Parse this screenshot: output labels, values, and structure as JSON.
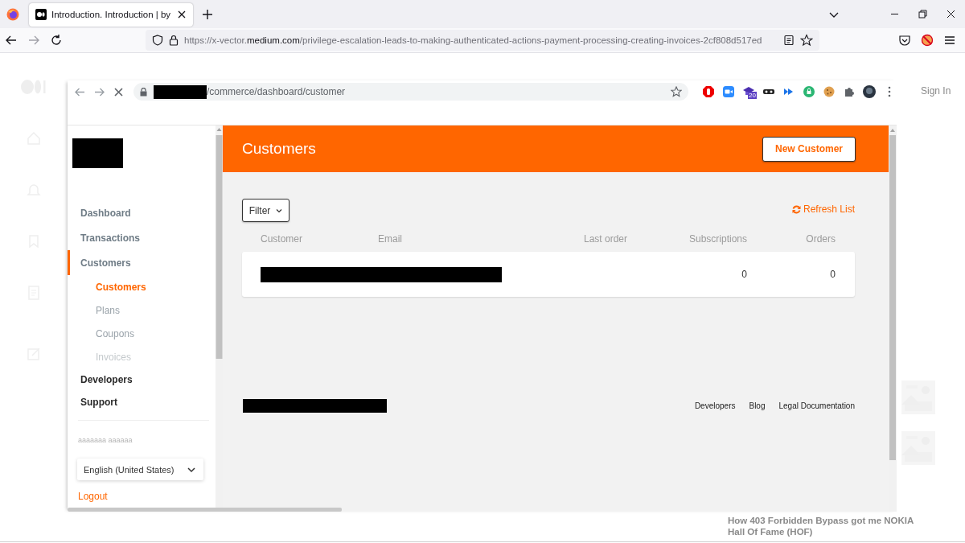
{
  "browser": {
    "tab_title": "Introduction. Introduction | by",
    "url": "https://x-vector.**medium.com**/privilege-escalation-leads-to-making-authenticated-actions-payment-processing-creating-invoices-2cf808d517ed"
  },
  "article_page": {
    "sign_in": "Sign In",
    "recommended_title": "How 403 Forbidden Bypass got me NOKIA Hall Of Fame (HOF)"
  },
  "screenshot": {
    "address_path": "/commerce/dashboard/customer",
    "extension_badge": "20",
    "sidebar": {
      "nav": [
        {
          "label": "Dashboard",
          "kind": "section",
          "selected": false
        },
        {
          "label": "Transactions",
          "kind": "section",
          "selected": false
        },
        {
          "label": "Customers",
          "kind": "section",
          "selected": true,
          "children": [
            {
              "label": "Customers",
              "selected": true
            },
            {
              "label": "Plans",
              "selected": false
            },
            {
              "label": "Coupons",
              "selected": false
            },
            {
              "label": "Invoices",
              "selected": false
            }
          ]
        },
        {
          "label": "Developers",
          "kind": "heading",
          "selected": false
        },
        {
          "label": "Support",
          "kind": "heading",
          "selected": false
        }
      ],
      "account_name": "aaaaaaa aaaaaa",
      "language": "English (United States)",
      "logout": "Logout"
    },
    "page_title": "Customers",
    "new_button": "New Customer",
    "filter_button": "Filter",
    "refresh_link": "Refresh List",
    "table": {
      "columns": [
        "Customer",
        "Email",
        "Last order",
        "Subscriptions",
        "Orders"
      ],
      "rows": [
        {
          "redacted": true,
          "subscriptions": "0",
          "orders": "0"
        }
      ]
    },
    "footer_links": [
      "Developers",
      "Blog",
      "Legal Documentation"
    ]
  }
}
